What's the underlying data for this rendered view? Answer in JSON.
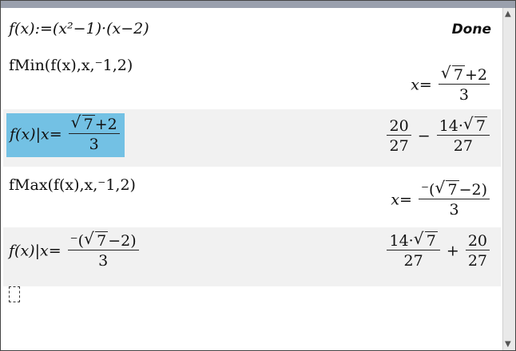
{
  "rows": [
    {
      "input": "f(x):=(x²−1)·(x−2)",
      "output": "Done"
    },
    {
      "input": "fMin(f(x),x,⁻1,2)",
      "output_prefix": "x=",
      "output_num_sqrt": "7",
      "output_num_tail": "+2",
      "output_den": "3"
    },
    {
      "input_prefix": "f(x)|x=",
      "input_num_sqrt": "7",
      "input_num_tail": "+2",
      "input_den": "3",
      "out_a_num": "20",
      "out_a_den": "27",
      "out_minus": "−",
      "out_b_num_pre": "14·",
      "out_b_num_sqrt": "7",
      "out_b_den": "27"
    },
    {
      "input": "fMax(f(x),x,⁻1,2)",
      "output_prefix": "x=",
      "output_num_pre": "⁻(",
      "output_num_sqrt": "7",
      "output_num_tail": "−2)",
      "output_den": "3"
    },
    {
      "input_prefix": "f(x)|x=",
      "input_num_pre": "⁻(",
      "input_num_sqrt": "7",
      "input_num_tail": "−2)",
      "input_den": "3",
      "out_a_num_pre": "14·",
      "out_a_num_sqrt": "7",
      "out_a_den": "27",
      "out_plus": "+",
      "out_b_num": "20",
      "out_b_den": "27"
    }
  ],
  "scroll": {
    "up": "▲",
    "down": "▼"
  },
  "colors": {
    "selection": "#73c1e4",
    "alt_row": "#f1f1f1",
    "topbar": "#9aa0ad"
  }
}
